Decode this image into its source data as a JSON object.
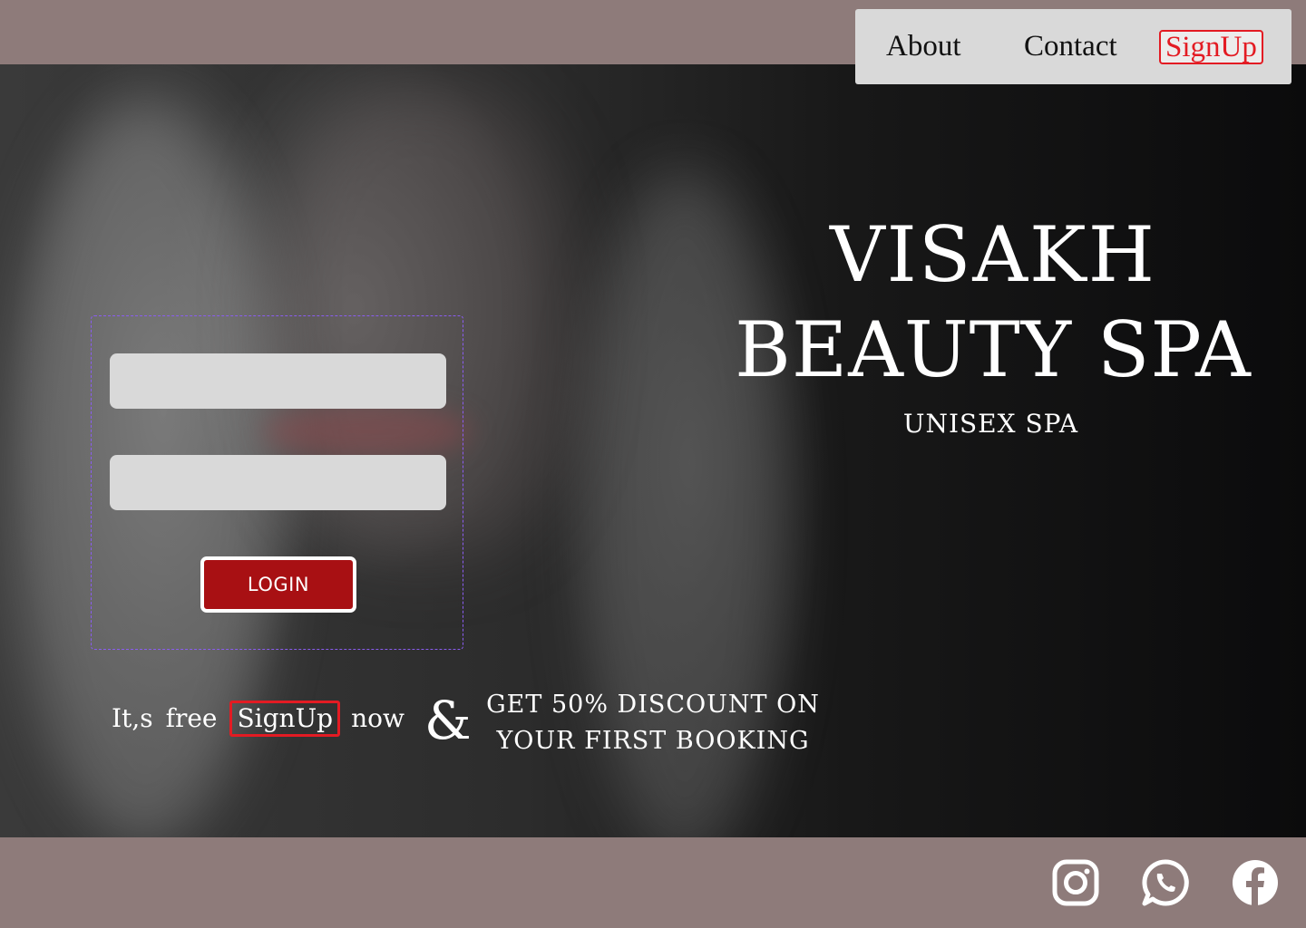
{
  "nav": {
    "about": "About",
    "contact": "Contact",
    "signup": "SignUp"
  },
  "hero": {
    "title_line1": "VISAKH",
    "title_line2": "BEAUTY SPA",
    "subtitle": "UNISEX SPA"
  },
  "login": {
    "username_placeholder": "",
    "password_placeholder": "",
    "button_label": "LOGIN"
  },
  "promo": {
    "word1": "It,s",
    "word2": "free",
    "signup_label": "SignUp",
    "word3": "now",
    "ampersand": "&",
    "discount_line1": "GET 50% DISCOUNT ON",
    "discount_line2": "YOUR FIRST BOOKING"
  },
  "footer": {
    "icons": [
      "instagram-icon",
      "whatsapp-icon",
      "facebook-icon"
    ]
  },
  "colors": {
    "background": "#8e7b7a",
    "nav_bg": "#d9d9d9",
    "accent_red": "#e31b23",
    "button_red": "#a81013",
    "form_outline": "#8a5cf0"
  }
}
